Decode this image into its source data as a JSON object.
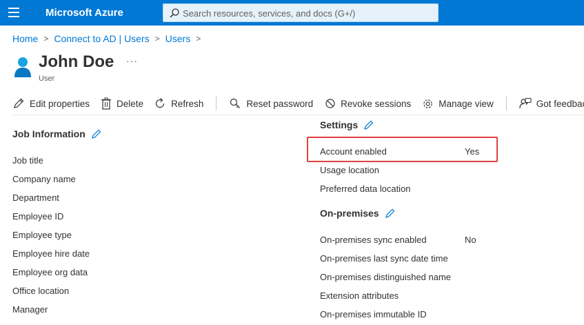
{
  "header": {
    "brand": "Microsoft Azure",
    "search_placeholder": "Search resources, services, and docs (G+/)"
  },
  "breadcrumb": [
    "Home",
    "Connect to AD | Users",
    "Users"
  ],
  "page": {
    "title": "John Doe",
    "subtitle": "User",
    "more": "···"
  },
  "toolbar": {
    "edit": "Edit properties",
    "delete": "Delete",
    "refresh": "Refresh",
    "reset_password": "Reset password",
    "revoke_sessions": "Revoke sessions",
    "manage_view": "Manage view",
    "feedback": "Got feedback?"
  },
  "job_info": {
    "title": "Job Information",
    "fields": [
      "Job title",
      "Company name",
      "Department",
      "Employee ID",
      "Employee type",
      "Employee hire date",
      "Employee org data",
      "Office location",
      "Manager"
    ]
  },
  "settings": {
    "title": "Settings",
    "fields": [
      {
        "label": "Account enabled",
        "value": "Yes"
      },
      {
        "label": "Usage location",
        "value": ""
      },
      {
        "label": "Preferred data location",
        "value": ""
      }
    ]
  },
  "on_premises": {
    "title": "On-premises",
    "fields": [
      {
        "label": "On-premises sync enabled",
        "value": "No"
      },
      {
        "label": "On-premises last sync date time",
        "value": ""
      },
      {
        "label": "On-premises distinguished name",
        "value": ""
      },
      {
        "label": "Extension attributes",
        "value": ""
      },
      {
        "label": "On-premises immutable ID",
        "value": ""
      }
    ]
  },
  "colors": {
    "brand": "#0078d4",
    "link": "#0078d4",
    "highlight": "#e04040"
  }
}
